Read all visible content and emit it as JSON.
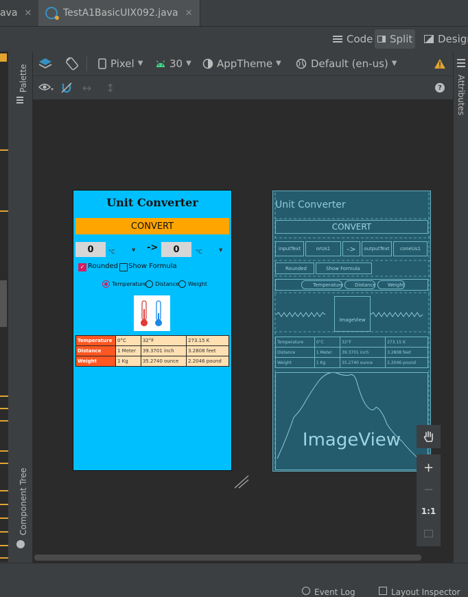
{
  "tabs": [
    {
      "label": "ava"
    },
    {
      "label": "TestA1BasicUIX092.java"
    }
  ],
  "view_modes": {
    "code": "Code",
    "split": "Split",
    "design": "Design"
  },
  "toolbar": {
    "device": "Pixel",
    "api": "30",
    "theme": "AppTheme",
    "locale": "Default (en-us)",
    "help": "?"
  },
  "side_panels": {
    "palette": "Palette",
    "component_tree": "Component Tree",
    "attributes": "Attributes"
  },
  "zoom": {
    "plus": "+",
    "minus": "−",
    "one_to_one": "1:1"
  },
  "bottom": {
    "event_log": "Event Log",
    "layout_inspector": "Layout Inspector"
  },
  "colors": {
    "background_blue": "#00bfff",
    "convert_orange": "#ffa500",
    "table_header": "#ff5722",
    "table_cell": "#ffe0b2",
    "accent_pink": "#d81b60",
    "warning": "#e2a42f"
  },
  "app": {
    "title": "Unit Converter",
    "convert_button": "CONVERT",
    "input_value": "0",
    "output_value": "0",
    "unit_in": "°C",
    "unit_out": "°C",
    "arrow": "->",
    "rounded": "Rounded",
    "show_formula": "Show Formula",
    "radios": [
      "Temperature",
      "Distance",
      "Weight"
    ],
    "table": [
      [
        "Temperature",
        "0°C",
        "32°F",
        "273.15 K"
      ],
      [
        "Distance",
        "1 Meter",
        "39.3701 inch",
        "3.2808 feet"
      ],
      [
        "Weight",
        "1 Kg",
        "35.2740 ounce",
        "2.2046 pound"
      ]
    ]
  },
  "blueprint": {
    "title": "Unit Converter",
    "convert": "CONVERT",
    "row1": [
      "inputText",
      "orUs1",
      "->",
      "outputText",
      "coneUs1"
    ],
    "rounded": "Rounded",
    "show_formula": "Show Formula",
    "radios": [
      "Temperature",
      "Distance",
      "Weight"
    ],
    "image_small": "ImageView",
    "table": [
      [
        "Temperature",
        "0°C",
        "32°F",
        "273.15 K"
      ],
      [
        "Distance",
        "1 Meter",
        "39.3701 inch",
        "3.2808 feet"
      ],
      [
        "Weight",
        "1 Kg",
        "35.2740 ounce",
        "2.2046 pound"
      ]
    ],
    "image_big": "ImageView"
  }
}
